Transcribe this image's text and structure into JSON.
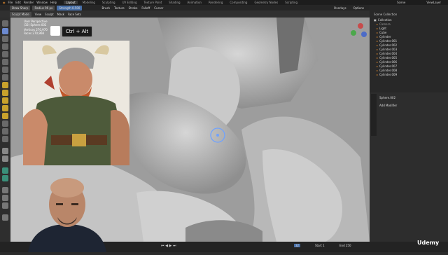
{
  "app": {
    "menu": [
      "File",
      "Edit",
      "Render",
      "Window",
      "Help"
    ],
    "workspaces": [
      "Layout",
      "Modeling",
      "Sculpting",
      "UV Editing",
      "Texture Paint",
      "Shading",
      "Animation",
      "Rendering",
      "Compositing",
      "Geometry Nodes",
      "Scripting"
    ],
    "active_workspace": "Layout",
    "scene_label": "Scene",
    "view_layer_label": "ViewLayer"
  },
  "header": {
    "mode": "Sculpt Mode",
    "view": "View",
    "sculpt": "Sculpt",
    "mask": "Mask",
    "face_sets": "Face Sets",
    "brush_name": "Draw Sharp",
    "radius_label": "Radius",
    "radius_value": "96 px",
    "strength_label": "Strength",
    "strength_value": "0.500",
    "brush_menu": "Brush",
    "texture_menu": "Texture",
    "stroke_menu": "Stroke",
    "falloff_menu": "Falloff",
    "cursor_menu": "Cursor",
    "overlay": "Overlays",
    "options": "Options"
  },
  "viewport": {
    "perspective": "User Perspective",
    "object": "(32) Sphere.002",
    "vertices_label": "Vertices",
    "vertices_value": "270,970",
    "faces_label": "Faces",
    "faces_value": "270,968",
    "key_hint": "Ctrl + Alt"
  },
  "outliner": {
    "title": "Scene Collection",
    "items": [
      "Collection",
      "Camera",
      "Light",
      "Cube",
      "Cylinder",
      "Cylinder.001",
      "Cylinder.002",
      "Cylinder.003",
      "Cylinder.004",
      "Cylinder.005",
      "Cylinder.006",
      "Cylinder.007",
      "Cylinder.008",
      "Cylinder.009"
    ]
  },
  "properties": {
    "object_name": "Sphere.002",
    "add_modifier": "Add Modifier"
  },
  "timeline": {
    "start_label": "Start",
    "start_value": "1",
    "end_label": "End",
    "end_value": "250",
    "current_frame": "32"
  },
  "brand": "Udemy",
  "colors": {
    "accent": "#476fa8",
    "orange": "#e08a2e",
    "viewport": "#a8a8a8"
  }
}
